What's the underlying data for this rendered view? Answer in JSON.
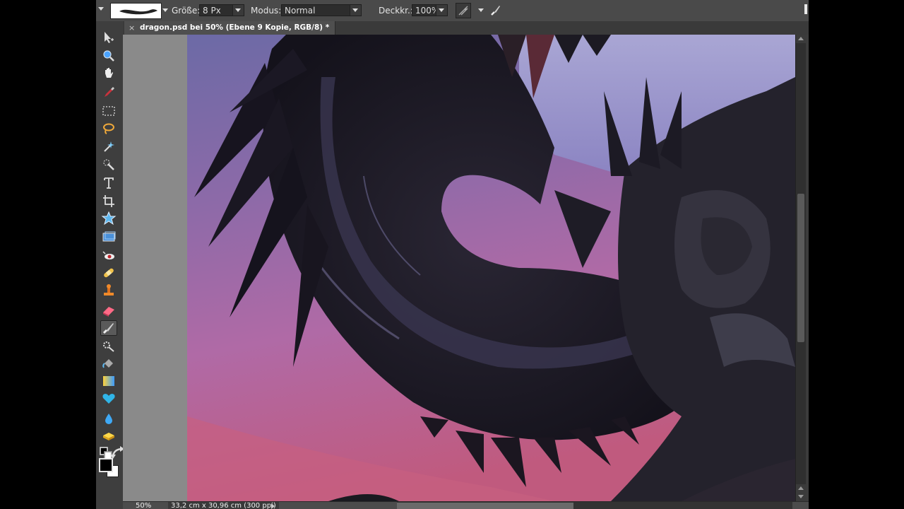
{
  "options_bar": {
    "size_label": "Größe:",
    "size_value": "8 Px",
    "mode_label": "Modus:",
    "mode_value": "Normal",
    "opacity_label": "Deckkr.:",
    "opacity_value": "100%"
  },
  "document_tab": {
    "title": "dragon.psd bei 50% (Ebene 9 Kopie, RGB/8) *",
    "close": "×"
  },
  "status_bar": {
    "zoom": "50%",
    "doc_size": "33,2 cm x 30,96 cm (300 ppi)"
  },
  "tools": [
    "move-tool-icon",
    "zoom-tool-icon",
    "hand-tool-icon",
    "eyedropper-tool-icon",
    "rectangular-marquee-tool-icon",
    "lasso-tool-icon",
    "magic-wand-tool-icon",
    "quick-selection-tool-icon",
    "type-tool-icon",
    "crop-tool-icon",
    "cookie-cutter-tool-icon",
    "straighten-tool-icon",
    "red-eye-tool-icon",
    "spot-healing-brush-tool-icon",
    "clone-stamp-tool-icon",
    "eraser-tool-icon",
    "brush-tool-icon",
    "smart-brush-tool-icon",
    "paint-bucket-tool-icon",
    "gradient-tool-icon",
    "custom-shape-tool-icon",
    "blur-tool-icon",
    "sponge-tool-icon",
    "default-colors-icon",
    "swap-colors-icon",
    "foreground-background-color-icon"
  ],
  "colors": {
    "foreground": "#000000",
    "background": "#ffffff"
  }
}
